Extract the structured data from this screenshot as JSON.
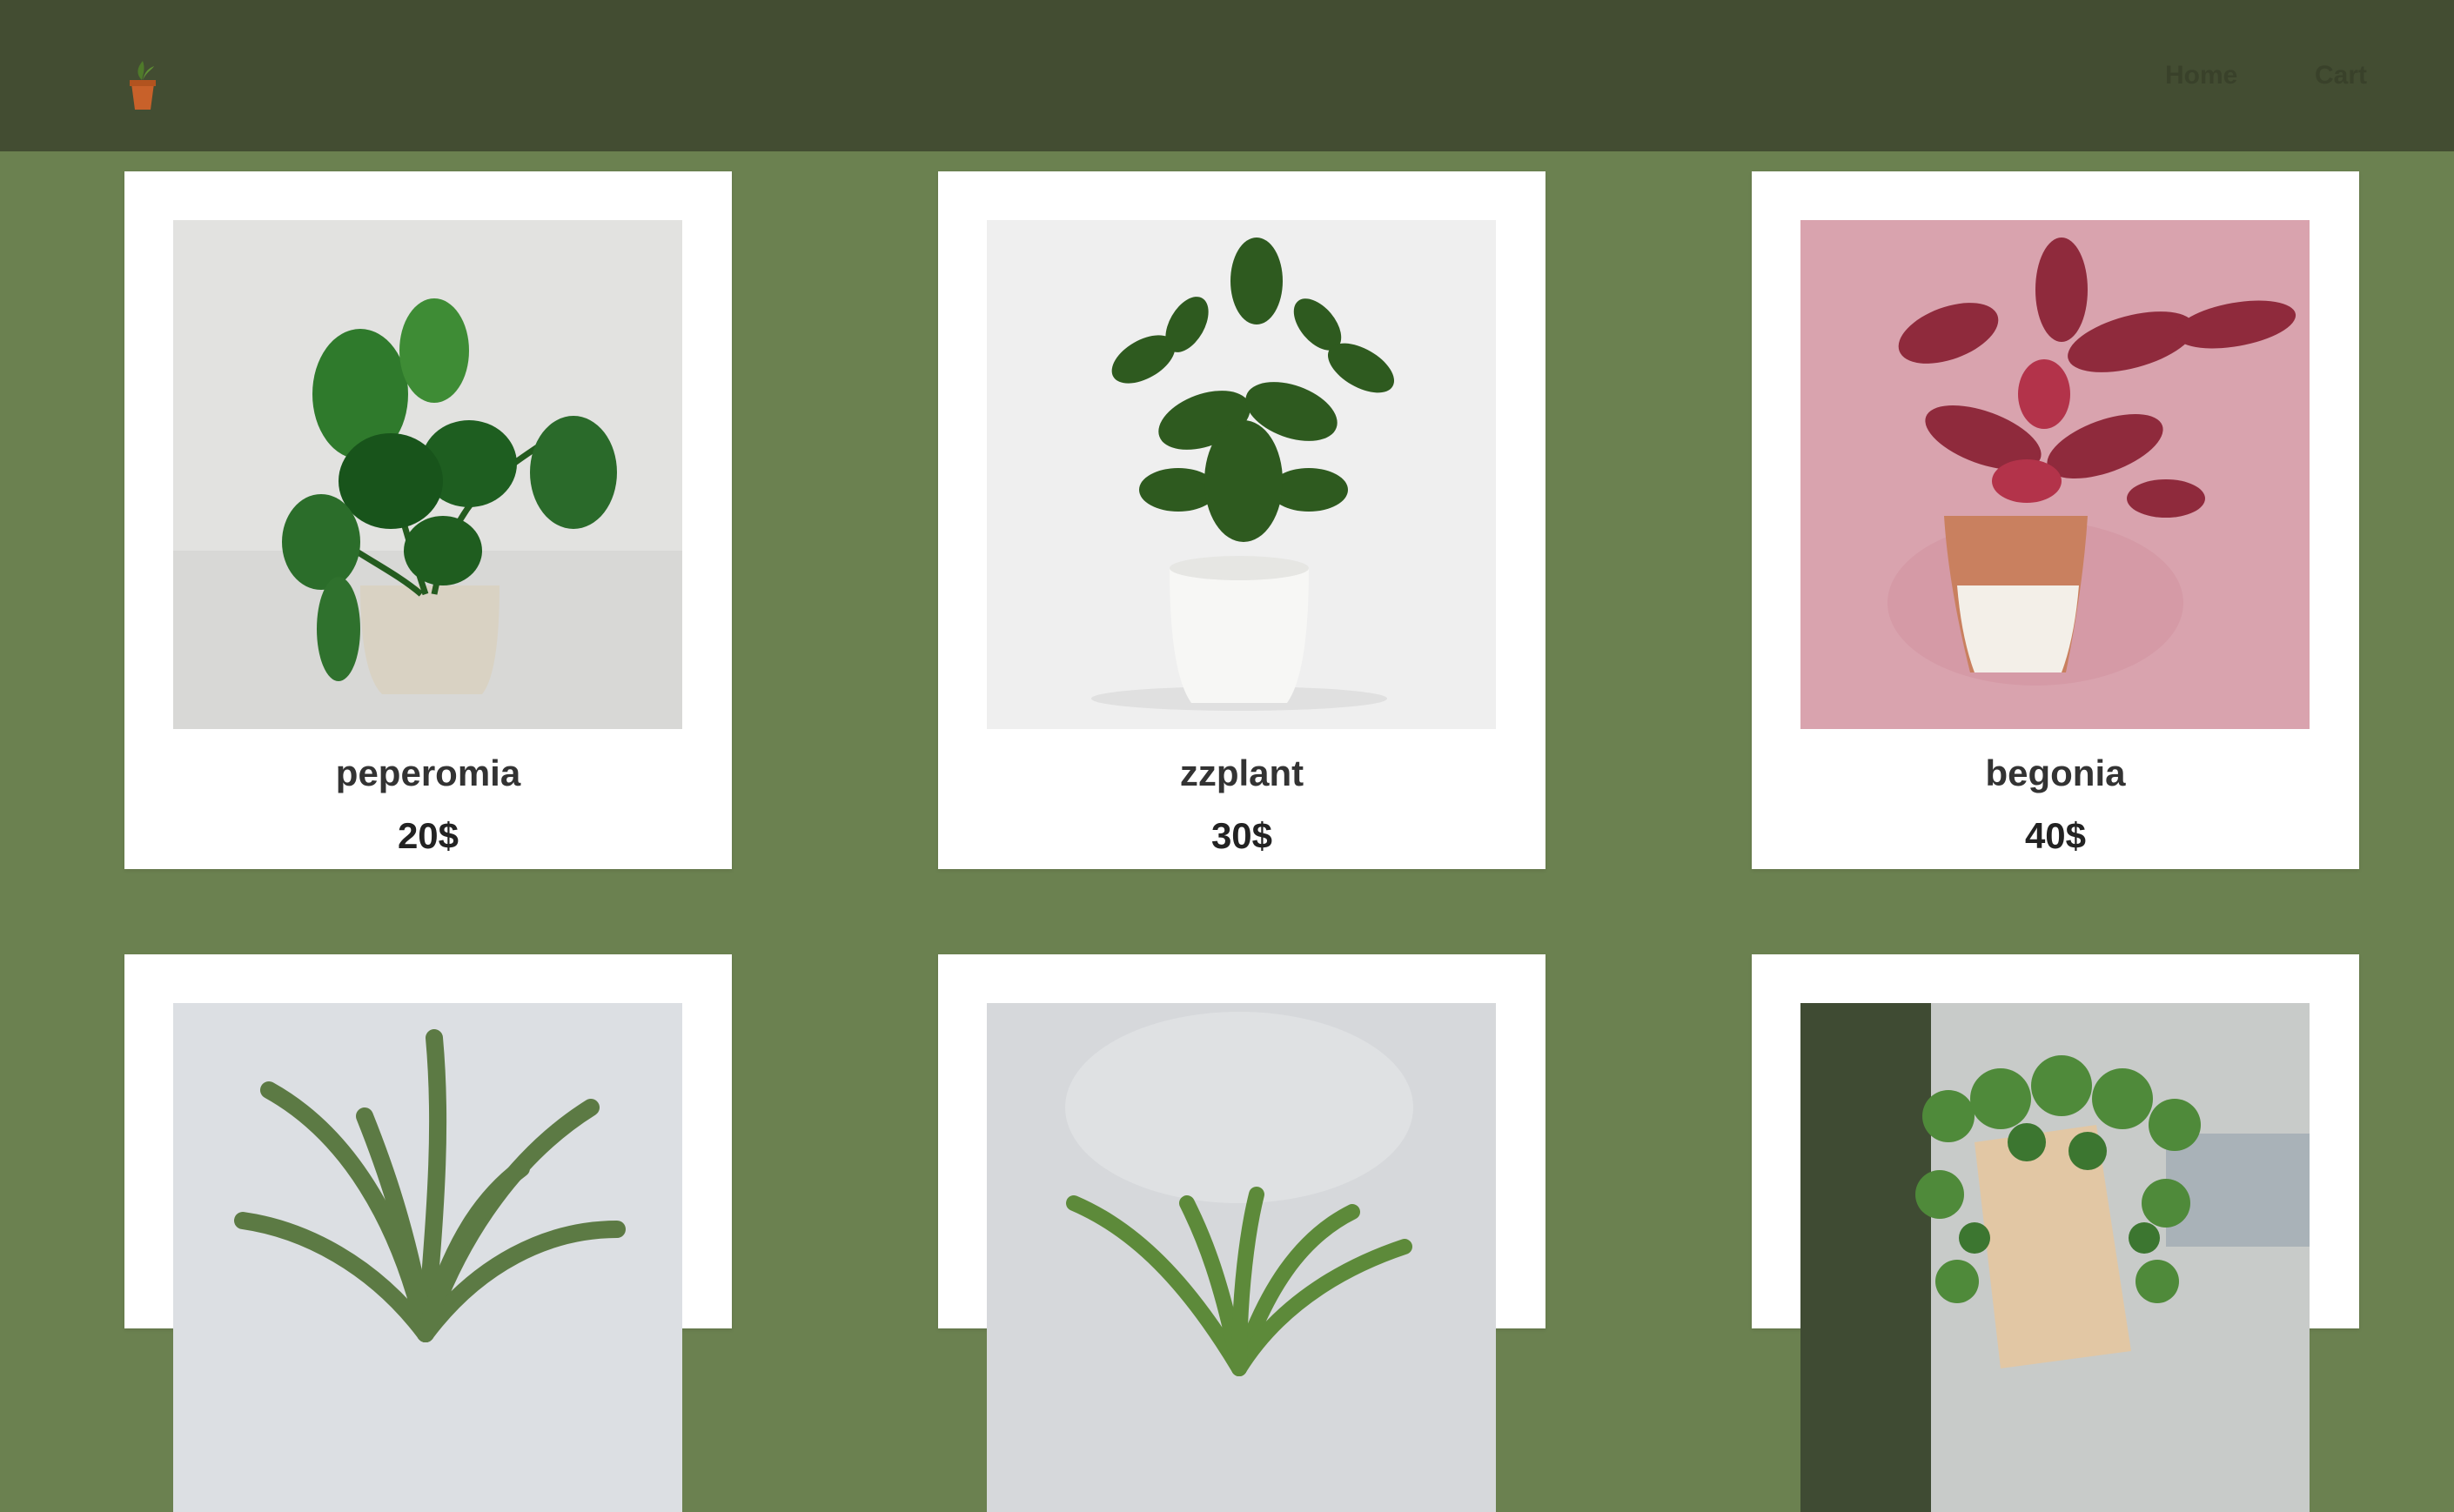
{
  "header": {
    "logo_icon": "potted-plant-logo-icon",
    "nav": [
      {
        "label": "Home"
      },
      {
        "label": "Cart"
      }
    ],
    "colors": {
      "bar": "#434d32",
      "page": "#6b8150"
    }
  },
  "products": [
    {
      "name": "peperomia",
      "price": "20$",
      "image": "peperomia-photo",
      "photo_bg": "#e4e4e4"
    },
    {
      "name": "zzplant",
      "price": "30$",
      "image": "zz-plant-photo",
      "photo_bg": "#eeeeee"
    },
    {
      "name": "begonia",
      "price": "40$",
      "image": "begonia-photo",
      "photo_bg": "#d9a3ae"
    },
    {
      "name": "",
      "price": "",
      "image": "dracaena-photo",
      "photo_bg": "#dcdfe3"
    },
    {
      "name": "",
      "price": "",
      "image": "spider-plant-photo",
      "photo_bg": "#d6d8db"
    },
    {
      "name": "",
      "price": "",
      "image": "string-of-pearls-photo",
      "photo_bg": "#c8cbc9"
    }
  ]
}
